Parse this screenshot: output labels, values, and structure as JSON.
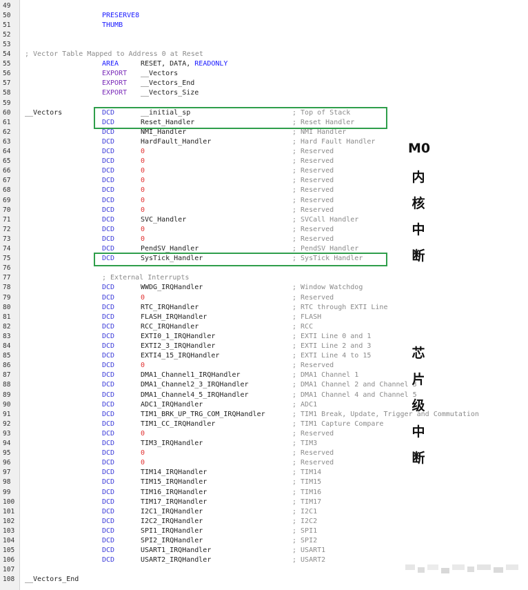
{
  "lines": [
    {
      "n": "49"
    },
    {
      "n": "50",
      "dir": "PRESERVE8",
      "dirColor": "blue"
    },
    {
      "n": "51",
      "dir": "THUMB",
      "dirColor": "blue"
    },
    {
      "n": "52"
    },
    {
      "n": "53"
    },
    {
      "n": "54",
      "comment_full": "; Vector Table Mapped to Address 0 at Reset"
    },
    {
      "n": "55",
      "dir": "AREA",
      "dirColor": "blue",
      "op": "RESET, DATA, ",
      "op2": "READONLY"
    },
    {
      "n": "56",
      "dir": "EXPORT",
      "dirColor": "purple",
      "op": "__Vectors"
    },
    {
      "n": "57",
      "dir": "EXPORT",
      "dirColor": "purple",
      "op": "__Vectors_End"
    },
    {
      "n": "58",
      "dir": "EXPORT",
      "dirColor": "purple",
      "op": "__Vectors_Size"
    },
    {
      "n": "59"
    },
    {
      "n": "60",
      "label": "__Vectors",
      "dir": "DCD",
      "op": "__initial_sp",
      "cm": "; Top of Stack"
    },
    {
      "n": "61",
      "dir": "DCD",
      "op": "Reset_Handler",
      "cm": "; Reset Handler"
    },
    {
      "n": "62",
      "dir": "DCD",
      "op": "NMI_Handler",
      "cm": "; NMI Handler"
    },
    {
      "n": "63",
      "dir": "DCD",
      "op": "HardFault_Handler",
      "cm": "; Hard Fault Handler"
    },
    {
      "n": "64",
      "dir": "DCD",
      "op": "0",
      "zero": true,
      "cm": "; Reserved"
    },
    {
      "n": "65",
      "dir": "DCD",
      "op": "0",
      "zero": true,
      "cm": "; Reserved"
    },
    {
      "n": "66",
      "dir": "DCD",
      "op": "0",
      "zero": true,
      "cm": "; Reserved"
    },
    {
      "n": "67",
      "dir": "DCD",
      "op": "0",
      "zero": true,
      "cm": "; Reserved"
    },
    {
      "n": "68",
      "dir": "DCD",
      "op": "0",
      "zero": true,
      "cm": "; Reserved"
    },
    {
      "n": "69",
      "dir": "DCD",
      "op": "0",
      "zero": true,
      "cm": "; Reserved"
    },
    {
      "n": "70",
      "dir": "DCD",
      "op": "0",
      "zero": true,
      "cm": "; Reserved"
    },
    {
      "n": "71",
      "dir": "DCD",
      "op": "SVC_Handler",
      "cm": "; SVCall Handler"
    },
    {
      "n": "72",
      "dir": "DCD",
      "op": "0",
      "zero": true,
      "cm": "; Reserved"
    },
    {
      "n": "73",
      "dir": "DCD",
      "op": "0",
      "zero": true,
      "cm": "; Reserved"
    },
    {
      "n": "74",
      "dir": "DCD",
      "op": "PendSV_Handler",
      "cm": "; PendSV Handler"
    },
    {
      "n": "75",
      "dir": "DCD",
      "op": "SysTick_Handler",
      "cm": "; SysTick Handler"
    },
    {
      "n": "76"
    },
    {
      "n": "77",
      "comment_indent": "; External Interrupts"
    },
    {
      "n": "78",
      "dir": "DCD",
      "op": "WWDG_IRQHandler",
      "cm": "; Window Watchdog"
    },
    {
      "n": "79",
      "dir": "DCD",
      "op": "0",
      "zero": true,
      "cm": "; Reserved"
    },
    {
      "n": "80",
      "dir": "DCD",
      "op": "RTC_IRQHandler",
      "cm": "; RTC through EXTI Line"
    },
    {
      "n": "81",
      "dir": "DCD",
      "op": "FLASH_IRQHandler",
      "cm": "; FLASH"
    },
    {
      "n": "82",
      "dir": "DCD",
      "op": "RCC_IRQHandler",
      "cm": "; RCC"
    },
    {
      "n": "83",
      "dir": "DCD",
      "op": "EXTI0_1_IRQHandler",
      "cm": "; EXTI Line 0 and 1"
    },
    {
      "n": "84",
      "dir": "DCD",
      "op": "EXTI2_3_IRQHandler",
      "cm": "; EXTI Line 2 and 3"
    },
    {
      "n": "85",
      "dir": "DCD",
      "op": "EXTI4_15_IRQHandler",
      "cm": "; EXTI Line 4 to 15"
    },
    {
      "n": "86",
      "dir": "DCD",
      "op": "0",
      "zero": true,
      "cm": "; Reserved"
    },
    {
      "n": "87",
      "dir": "DCD",
      "op": "DMA1_Channel1_IRQHandler",
      "cm": "; DMA1 Channel 1"
    },
    {
      "n": "88",
      "dir": "DCD",
      "op": "DMA1_Channel2_3_IRQHandler",
      "cm": "; DMA1 Channel 2 and Channel 3"
    },
    {
      "n": "89",
      "dir": "DCD",
      "op": "DMA1_Channel4_5_IRQHandler",
      "cm": "; DMA1 Channel 4 and Channel 5"
    },
    {
      "n": "90",
      "dir": "DCD",
      "op": "ADC1_IRQHandler",
      "cm": "; ADC1"
    },
    {
      "n": "91",
      "dir": "DCD",
      "op": "TIM1_BRK_UP_TRG_COM_IRQHandler",
      "cm": "; TIM1 Break, Update, Trigger and Commutation"
    },
    {
      "n": "92",
      "dir": "DCD",
      "op": "TIM1_CC_IRQHandler",
      "cm": "; TIM1 Capture Compare"
    },
    {
      "n": "93",
      "dir": "DCD",
      "op": "0",
      "zero": true,
      "cm": "; Reserved"
    },
    {
      "n": "94",
      "dir": "DCD",
      "op": "TIM3_IRQHandler",
      "cm": "; TIM3"
    },
    {
      "n": "95",
      "dir": "DCD",
      "op": "0",
      "zero": true,
      "cm": "; Reserved"
    },
    {
      "n": "96",
      "dir": "DCD",
      "op": "0",
      "zero": true,
      "cm": "; Reserved"
    },
    {
      "n": "97",
      "dir": "DCD",
      "op": "TIM14_IRQHandler",
      "cm": "; TIM14"
    },
    {
      "n": "98",
      "dir": "DCD",
      "op": "TIM15_IRQHandler",
      "cm": "; TIM15"
    },
    {
      "n": "99",
      "dir": "DCD",
      "op": "TIM16_IRQHandler",
      "cm": "; TIM16"
    },
    {
      "n": "100",
      "dir": "DCD",
      "op": "TIM17_IRQHandler",
      "cm": "; TIM17"
    },
    {
      "n": "101",
      "dir": "DCD",
      "op": "I2C1_IRQHandler",
      "cm": "; I2C1"
    },
    {
      "n": "102",
      "dir": "DCD",
      "op": "I2C2_IRQHandler",
      "cm": "; I2C2"
    },
    {
      "n": "103",
      "dir": "DCD",
      "op": "SPI1_IRQHandler",
      "cm": "; SPI1"
    },
    {
      "n": "104",
      "dir": "DCD",
      "op": "SPI2_IRQHandler",
      "cm": "; SPI2"
    },
    {
      "n": "105",
      "dir": "DCD",
      "op": "USART1_IRQHandler",
      "cm": "; USART1"
    },
    {
      "n": "106",
      "dir": "DCD",
      "op": "USART2_IRQHandler",
      "cm": "; USART2"
    },
    {
      "n": "107"
    },
    {
      "n": "108",
      "label": "__Vectors_End"
    }
  ],
  "annotations": {
    "m0_core": [
      "M0",
      "内",
      "核",
      "中",
      "断"
    ],
    "chip_level": [
      "芯",
      "片",
      "级",
      "中",
      "断"
    ]
  },
  "colors": {
    "highlight_box": "#2e9e4a",
    "keyword_blue": "#1a1aff",
    "keyword_purple": "#7a2ab8",
    "zero_red": "#e03030",
    "comment_gray": "#8a8a8a"
  }
}
